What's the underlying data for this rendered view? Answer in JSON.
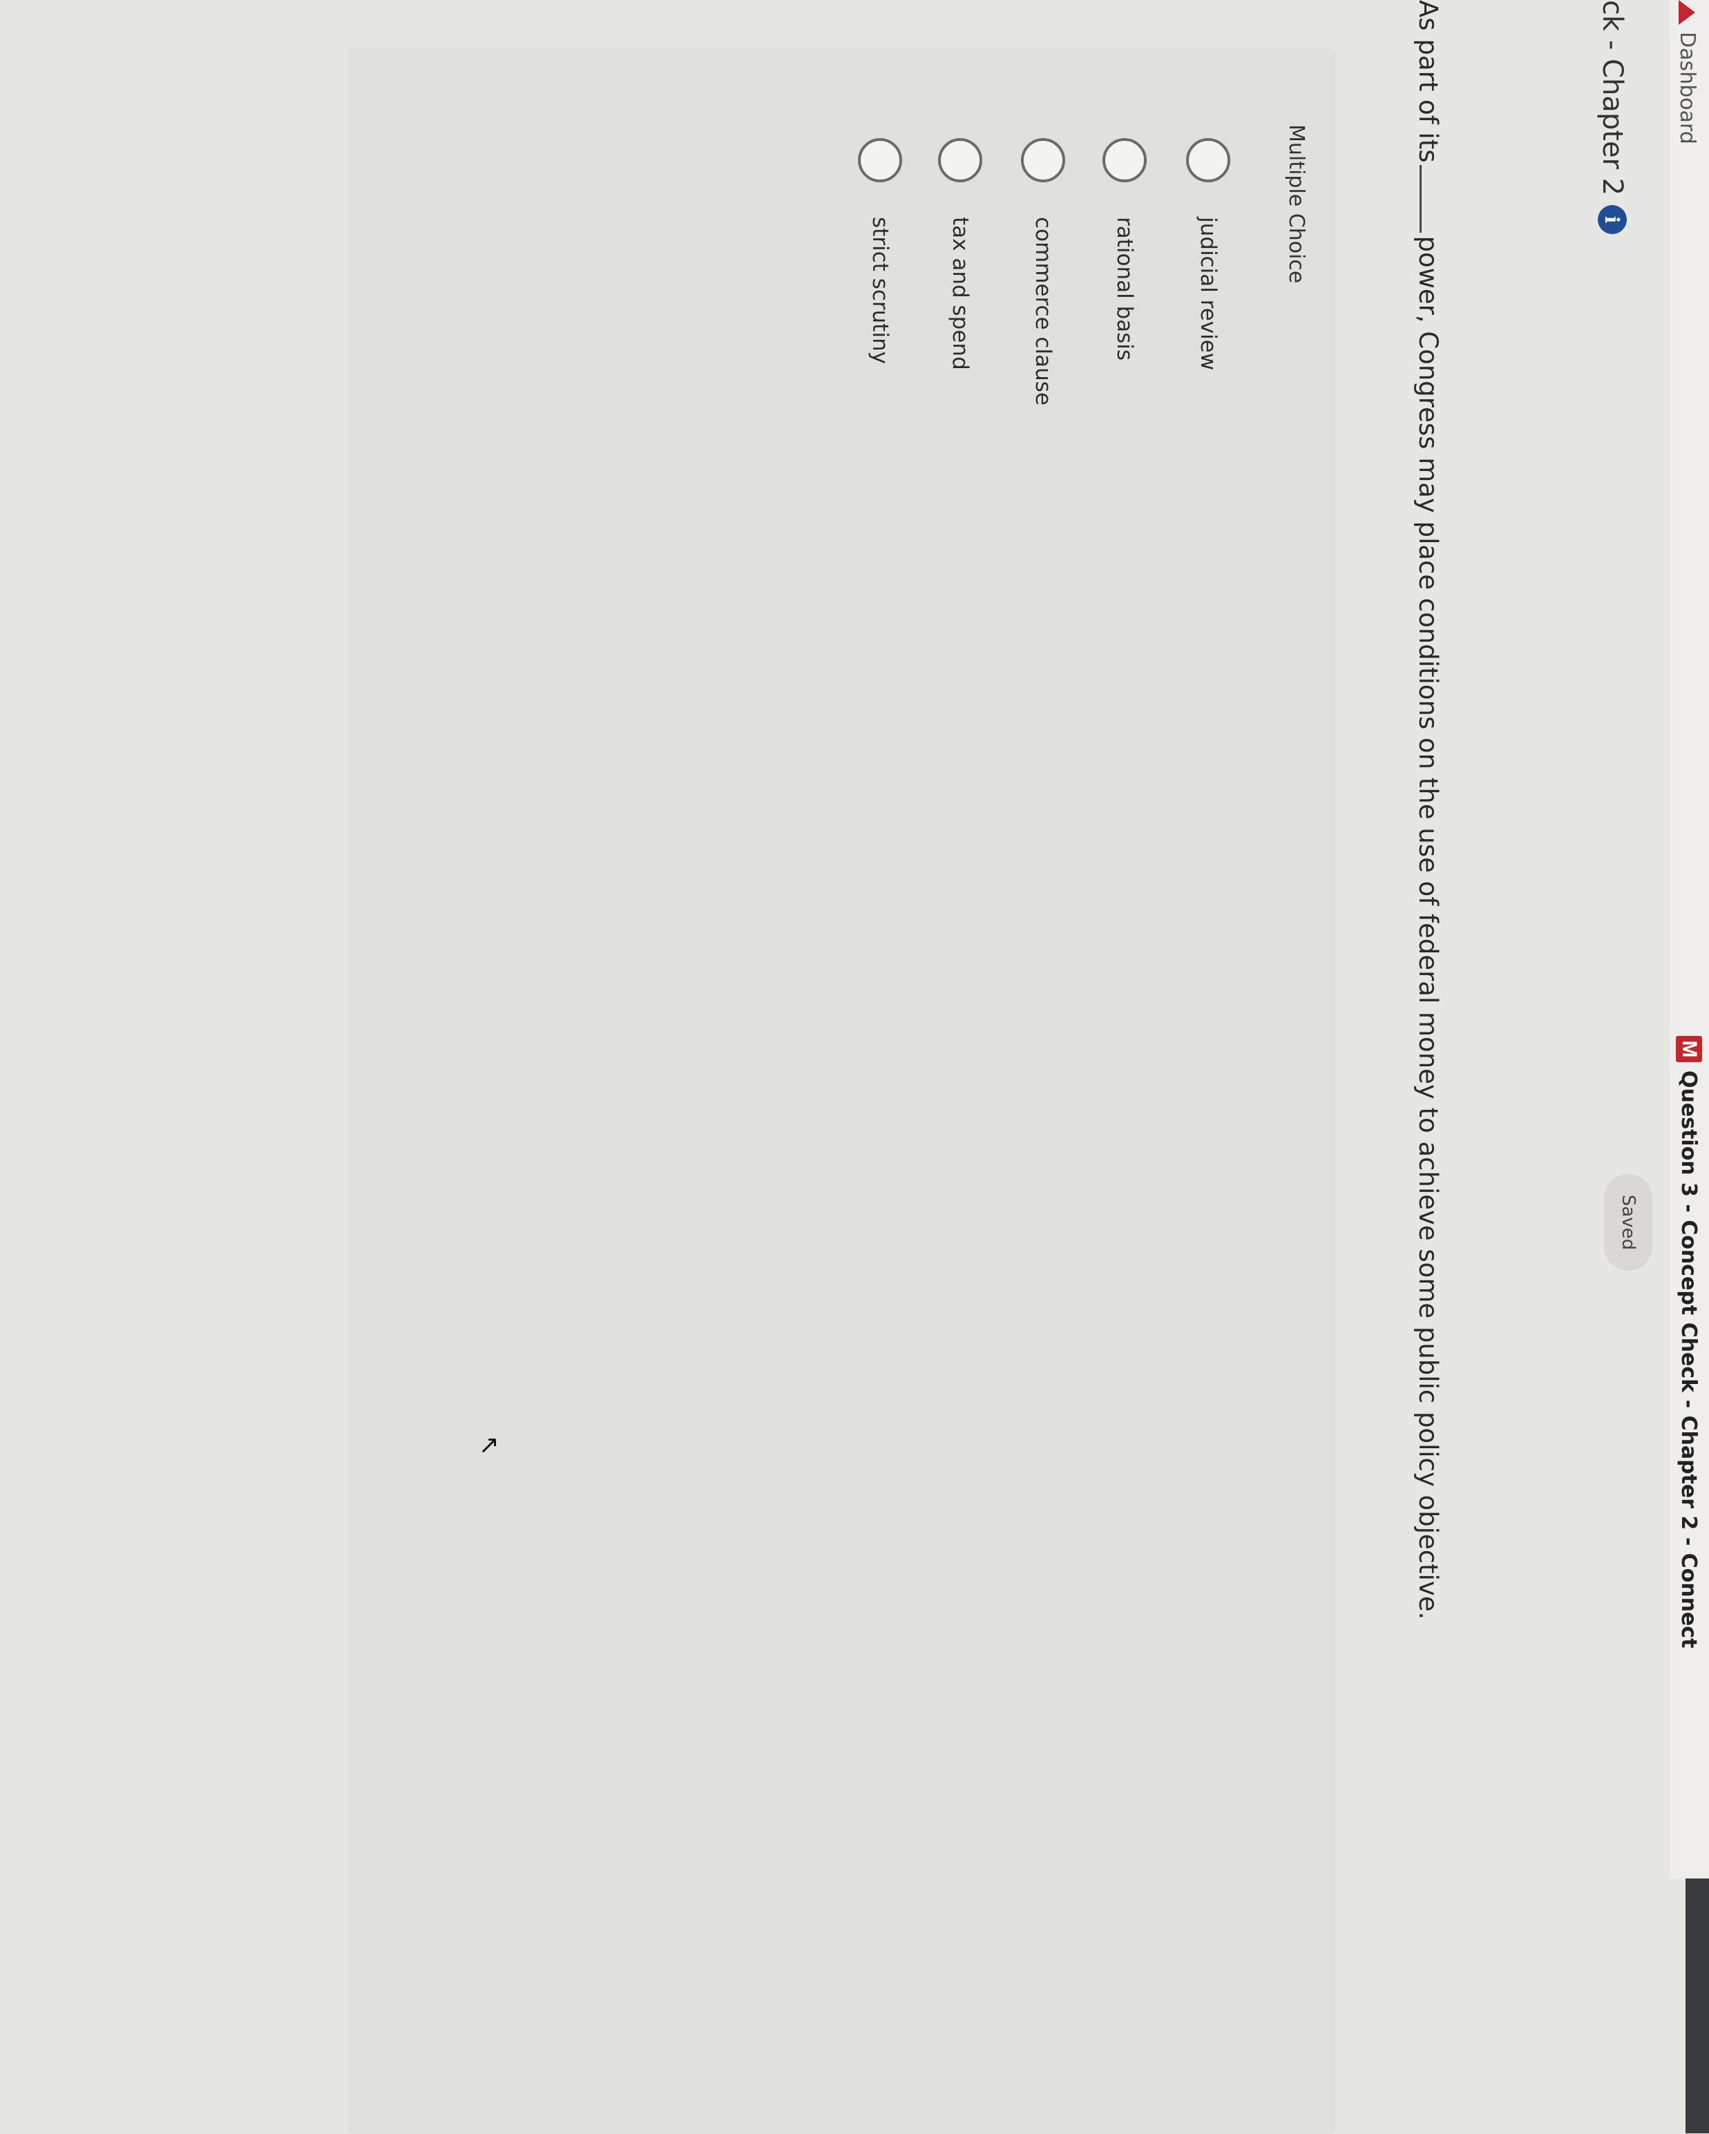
{
  "browser": {
    "dashboard_label": "Dashboard",
    "tab_title": "Question 3 - Concept Check - Chapter 2 - Connect",
    "tab_logo_letter": "M"
  },
  "header": {
    "breadcrumb": "ck - Chapter 2",
    "info_icon": "i",
    "saved_label": "Saved"
  },
  "question": {
    "before_blank": "As part of its",
    "after_blank": "power, Congress may place conditions on the use of federal money to achieve some public policy objective."
  },
  "multiple_choice": {
    "label": "Multiple Choice",
    "options": [
      {
        "label": "judicial review"
      },
      {
        "label": "rational basis"
      },
      {
        "label": "commerce clause"
      },
      {
        "label": "tax and spend"
      },
      {
        "label": "strict scrutiny"
      }
    ]
  },
  "colors": {
    "brand_red": "#c1272d",
    "info_blue": "#1f4e96"
  }
}
